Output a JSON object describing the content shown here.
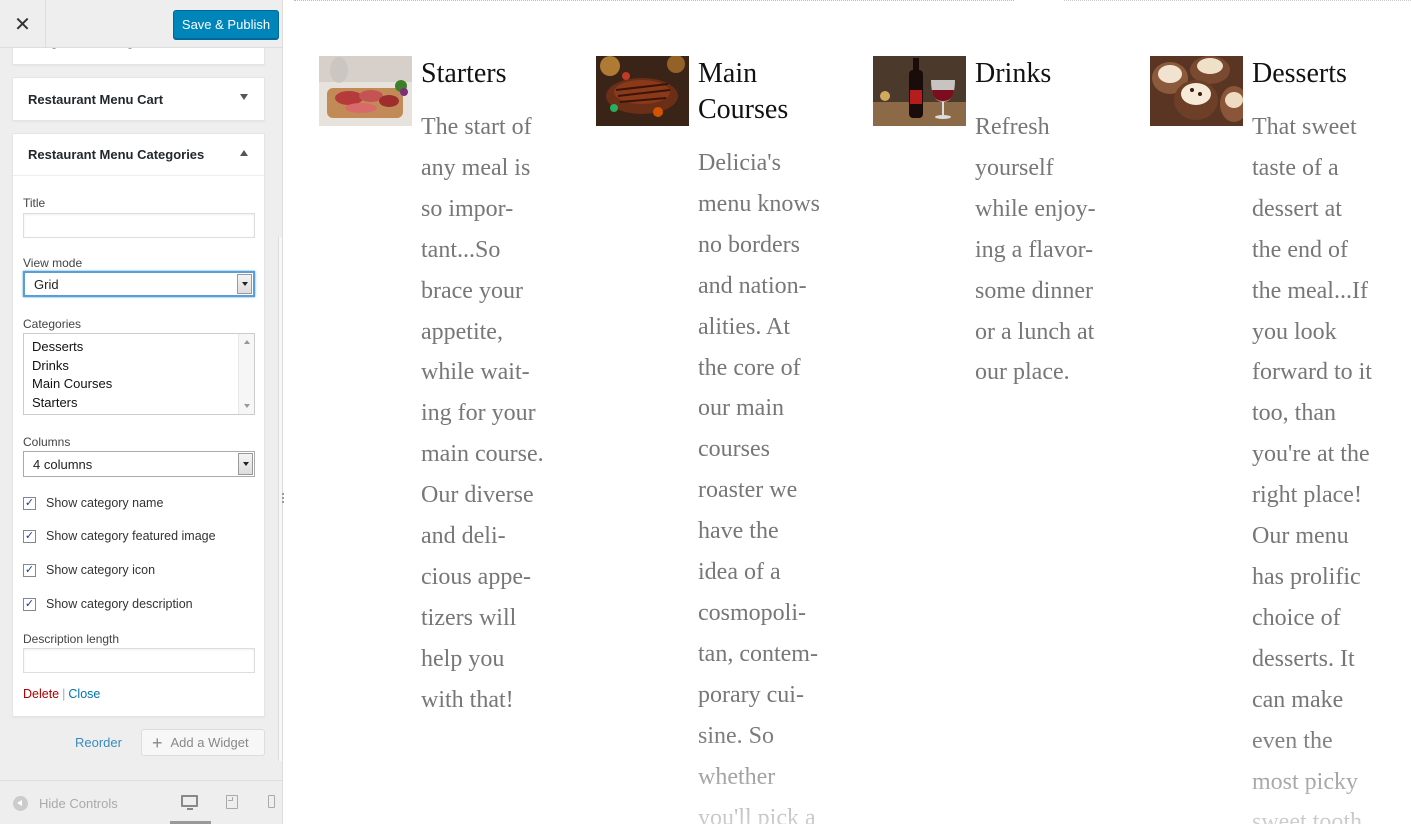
{
  "topbar": {
    "close_icon": "close-icon",
    "save_label": "Save & Publish"
  },
  "widgets": {
    "image_grid_title": "Image Grid: Image Grid",
    "cart_title": "Restaurant Menu Cart",
    "categories_title": "Restaurant Menu Categories"
  },
  "form": {
    "title_label": "Title",
    "title_value": "",
    "view_mode_label": "View mode",
    "view_mode_value": "Grid",
    "categories_label": "Categories",
    "categories_options": [
      "Desserts",
      "Drinks",
      "Main Courses",
      "Starters"
    ],
    "columns_label": "Columns",
    "columns_value": "4 columns",
    "checks": [
      {
        "label": "Show category name",
        "checked": true
      },
      {
        "label": "Show category featured image",
        "checked": true
      },
      {
        "label": "Show category icon",
        "checked": true
      },
      {
        "label": "Show category description",
        "checked": true
      }
    ],
    "description_length_label": "Description length",
    "description_length_value": "",
    "delete_label": "Delete",
    "separator": "|",
    "close_label": "Close"
  },
  "sidebar_footer": {
    "reorder_label": "Reorder",
    "add_widget_label": "Add a Widget",
    "hide_controls_label": "Hide Controls"
  },
  "preview": {
    "categories": [
      {
        "name": "Starters",
        "lines": [
          "The start of",
          "any meal is",
          "so impor-",
          "tant...So",
          "brace your",
          "appetite,",
          "while wait-",
          "ing for your",
          "main course.",
          "Our diverse",
          "and deli-",
          "cious appe-",
          "tizers will",
          "help you",
          "with that!"
        ]
      },
      {
        "name": "Main Courses",
        "name_lines": [
          "Main",
          "Courses"
        ],
        "lines": [
          "Delicia's",
          "menu knows",
          "no borders",
          "and nation-",
          "alities. At",
          "the core of",
          "our main",
          "courses",
          "roaster we",
          "have the",
          "idea of a",
          "cosmopoli-",
          "tan, contem-",
          "porary cui-",
          "sine. So",
          "whether",
          "you'll pick a"
        ]
      },
      {
        "name": "Drinks",
        "lines": [
          "Refresh",
          "yourself",
          "while enjoy-",
          "ing a flavor-",
          "some dinner",
          "or a lunch at",
          "our place."
        ]
      },
      {
        "name": "Desserts",
        "lines": [
          "That sweet",
          "taste of a",
          "dessert at",
          "the end of",
          "the meal...If",
          "you look",
          "forward to it",
          "too, than",
          "you're at the",
          "right place!",
          "Our menu",
          "has prolific",
          "choice of",
          "desserts. It",
          "can make",
          "even the",
          "most picky",
          "sweet tooth"
        ]
      }
    ]
  }
}
